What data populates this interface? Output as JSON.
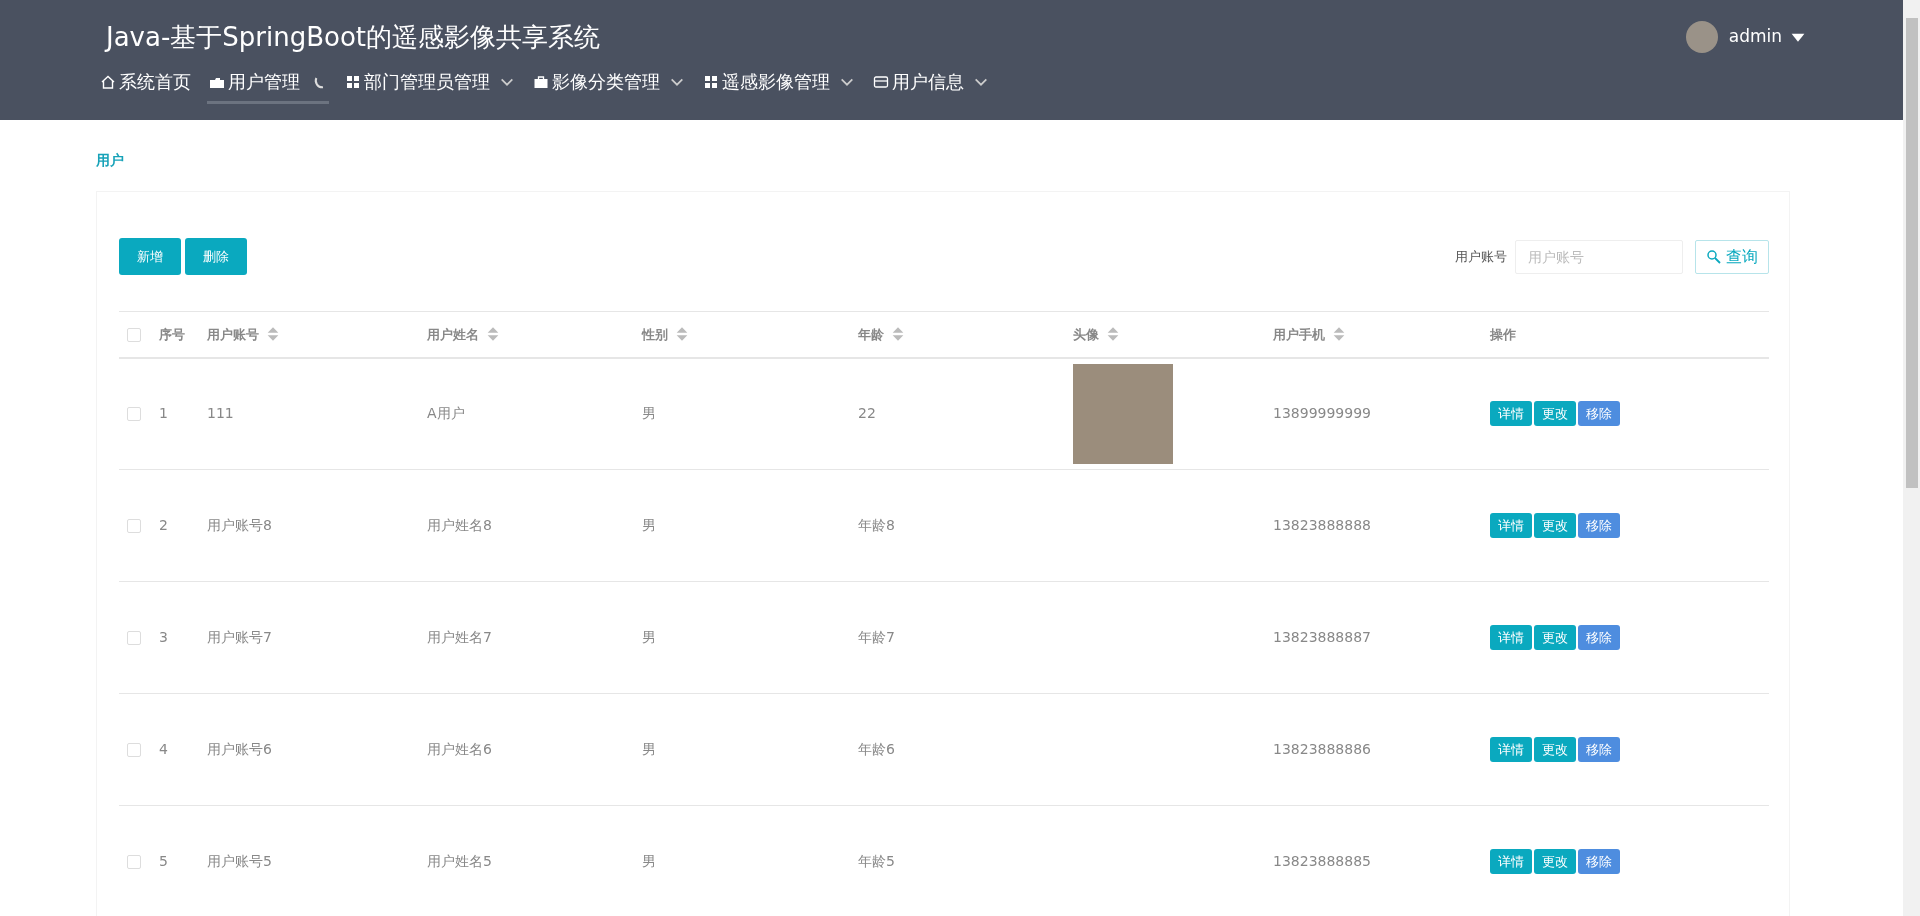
{
  "header": {
    "title": "Java-基于SpringBoot的遥感影像共享系统",
    "user": {
      "name": "admin"
    }
  },
  "nav": [
    {
      "label": "系统首页",
      "kind": "link",
      "selected": false
    },
    {
      "label": "用户管理",
      "kind": "loading",
      "selected": true
    },
    {
      "label": "部门管理员管理",
      "kind": "menu",
      "selected": false
    },
    {
      "label": "影像分类管理",
      "kind": "menu",
      "selected": false
    },
    {
      "label": "遥感影像管理",
      "kind": "menu",
      "selected": false
    },
    {
      "label": "用户信息",
      "kind": "menu",
      "selected": false
    }
  ],
  "breadcrumb": "用户",
  "toolbar": {
    "buttons": [
      "新增",
      "删除"
    ],
    "search": {
      "label": "用户账号",
      "placeholder": "用户账号",
      "button": "查询"
    }
  },
  "table": {
    "select_all": {
      "checked": false
    },
    "columns": [
      {
        "label": "序号",
        "sortable": false
      },
      {
        "label": "用户账号",
        "sortable": true
      },
      {
        "label": "用户姓名",
        "sortable": true
      },
      {
        "label": "性别",
        "sortable": true
      },
      {
        "label": "年龄",
        "sortable": true
      },
      {
        "label": "头像",
        "sortable": true
      },
      {
        "label": "用户手机",
        "sortable": true
      },
      {
        "label": "操作",
        "sortable": false
      }
    ],
    "rows": [
      {
        "checked": false,
        "cells": [
          "1",
          "111",
          "A用户",
          "男",
          "22"
        ],
        "photo": true,
        "phone": "13899999999",
        "actions": [
          {
            "label": "详情",
            "kind": "info"
          },
          {
            "label": "更改",
            "kind": "info"
          },
          {
            "label": "移除",
            "kind": "primary"
          }
        ]
      },
      {
        "checked": false,
        "cells": [
          "2",
          "用户账号8",
          "用户姓名8",
          "男",
          "年龄8"
        ],
        "photo": false,
        "phone": "13823888888",
        "actions": [
          {
            "label": "详情",
            "kind": "info"
          },
          {
            "label": "更改",
            "kind": "info"
          },
          {
            "label": "移除",
            "kind": "primary"
          }
        ]
      },
      {
        "checked": false,
        "cells": [
          "3",
          "用户账号7",
          "用户姓名7",
          "男",
          "年龄7"
        ],
        "photo": false,
        "phone": "13823888887",
        "actions": [
          {
            "label": "详情",
            "kind": "info"
          },
          {
            "label": "更改",
            "kind": "info"
          },
          {
            "label": "移除",
            "kind": "primary"
          }
        ]
      },
      {
        "checked": false,
        "cells": [
          "4",
          "用户账号6",
          "用户姓名6",
          "男",
          "年龄6"
        ],
        "photo": false,
        "phone": "13823888886",
        "actions": [
          {
            "label": "详情",
            "kind": "info"
          },
          {
            "label": "更改",
            "kind": "info"
          },
          {
            "label": "移除",
            "kind": "primary"
          }
        ]
      },
      {
        "checked": false,
        "cells": [
          "5",
          "用户账号5",
          "用户姓名5",
          "男",
          "年龄5"
        ],
        "photo": false,
        "phone": "13823888885",
        "actions": [
          {
            "label": "详情",
            "kind": "info"
          },
          {
            "label": "更改",
            "kind": "info"
          },
          {
            "label": "移除",
            "kind": "primary"
          }
        ]
      }
    ]
  }
}
